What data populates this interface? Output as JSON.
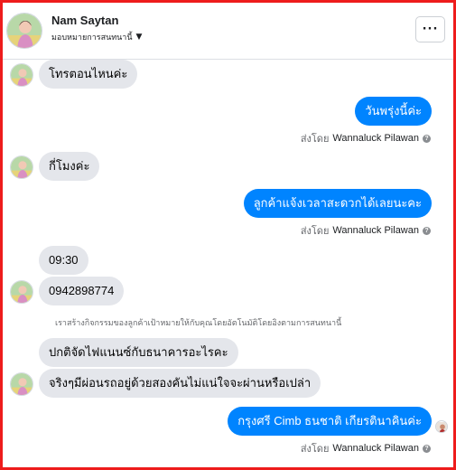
{
  "header": {
    "name": "Nam Saytan",
    "assign_label": "มอบหมายการสนทนานี้",
    "menu_label": "···"
  },
  "messages": [
    {
      "text": "โทรตอนไหนค่ะ"
    },
    {
      "text": "วันพรุ่งนี้ค่ะ"
    },
    {
      "text": "กี่โมงค่ะ"
    },
    {
      "text": "ลูกค้าแจ้งเวลาสะดวกได้เลยนะคะ"
    },
    {
      "text": "09:30"
    },
    {
      "text": "0942898774"
    },
    {
      "text": "ปกติจัดไฟแนนซ์กับธนาคารอะไรคะ"
    },
    {
      "text": "จริงๆมีผ่อนรถอยู่ด้วยสองคันไม่แน่ใจจะผ่านหรือเปล่า"
    },
    {
      "text": "กรุงศรี  Cimb ธนชาติ เกียรตินาคินค่ะ"
    }
  ],
  "sent_by": {
    "prefix": "ส่งโดย",
    "agent": "Wannaluck Pilawan"
  },
  "system_note": "เราสร้างกิจกรรมของลูกค้าเป้าหมายให้กับคุณโดยอัตโนมัติโดยอิงตามการสนทนานี้",
  "colors": {
    "outgoing": "#0084ff",
    "incoming": "#e4e6eb",
    "frame": "#ee1c1c"
  }
}
